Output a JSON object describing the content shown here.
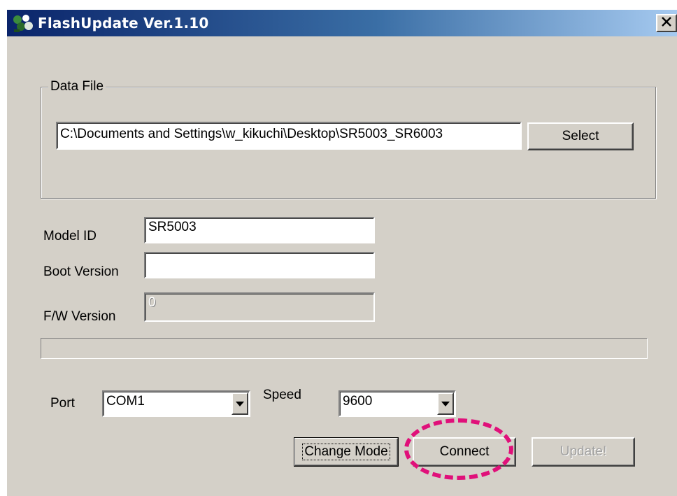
{
  "window": {
    "title": "FlashUpdate Ver.1.10",
    "close_glyph": "✕"
  },
  "data_file": {
    "legend": "Data File",
    "path_value": "C:\\Documents and Settings\\w_kikuchi\\Desktop\\SR5003_SR6003",
    "select_label": "Select"
  },
  "fields": {
    "model_id_label": "Model ID",
    "model_id_value": "SR5003",
    "boot_version_label": "Boot Version",
    "boot_version_value": "",
    "fw_version_label": "F/W Version",
    "fw_version_value": "0"
  },
  "progress": {
    "value": 0
  },
  "port": {
    "label": "Port",
    "selected": "COM1"
  },
  "speed": {
    "label": "Speed",
    "selected": "9600"
  },
  "buttons": {
    "change_mode": "Change Mode",
    "connect": "Connect",
    "update": "Update!"
  },
  "colors": {
    "title_start": "#0a246a",
    "title_end": "#a6caf0",
    "dialog_bg": "#d4d0c8",
    "highlight": "#e0107a"
  },
  "icons": {
    "app": "flashupdate-app-icon",
    "close": "close-icon",
    "dropdown": "chevron-down-icon"
  }
}
